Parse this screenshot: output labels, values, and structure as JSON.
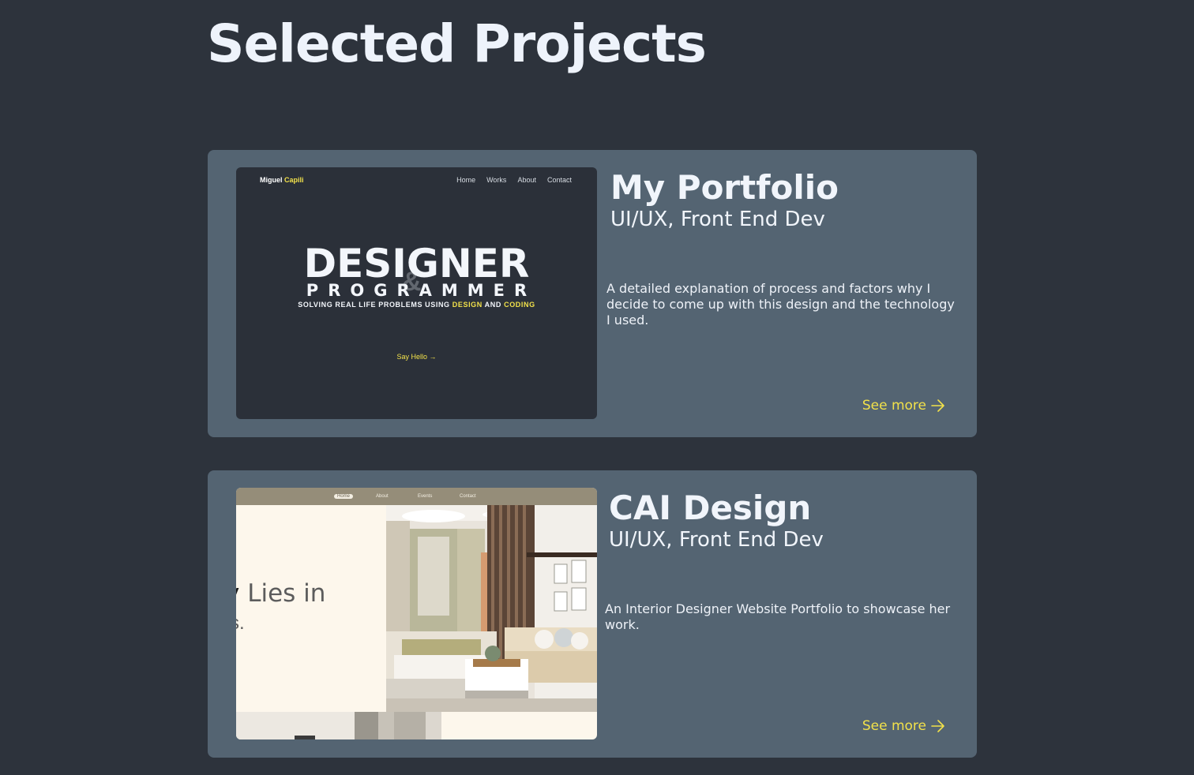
{
  "section": {
    "title": "Selected Projects"
  },
  "projects": [
    {
      "title": "My Portfolio",
      "subtitle": "UI/UX, Front End Dev",
      "description": "A detailed explanation of process and factors why I decide to come up with this design and the technology I used.",
      "link_label": "See more",
      "preview": {
        "logo_first": "Miguel",
        "logo_last": "Capili",
        "nav": [
          "Home",
          "Works",
          "About",
          "Contact"
        ],
        "headline": "DESIGNER",
        "subheadline": "PROGRAMMER",
        "tagline_start": "SOLVING REAL LIFE PROBLEMS USING",
        "tagline_design": "DESIGN",
        "tagline_and": "AND",
        "tagline_coding": "CODING",
        "cta": "Say Hello →"
      }
    },
    {
      "title": "CAI Design",
      "subtitle": "UI/UX, Front End Dev",
      "description": "An Interior Designer Website Portfolio to showcase her work.",
      "link_label": "See more",
      "preview": {
        "nav": [
          "Home",
          "About",
          "Events",
          "Contact"
        ],
        "hero_line1_a": "y",
        "hero_line1_b": " Lies in",
        "hero_line2": "s."
      }
    }
  ],
  "colors": {
    "background": "#2d333c",
    "card": "#546472",
    "accent": "#f2e14a",
    "text": "#f1f5fb"
  },
  "icons": {
    "see_more": "arrow-right-icon"
  }
}
